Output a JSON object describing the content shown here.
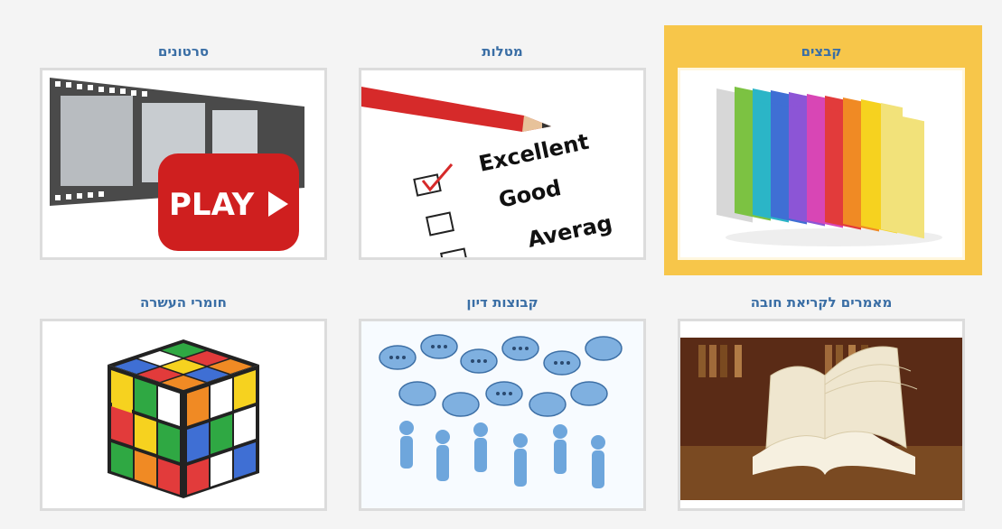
{
  "colors": {
    "title": "#3a6ea5",
    "selected": "#f7c64a",
    "frame_border": "#dcdcdc"
  },
  "tiles": [
    {
      "title": "קבצים",
      "image": "folders-icon",
      "selected": true
    },
    {
      "title": "מטלות",
      "image": "checklist-icon"
    },
    {
      "title": "סרטונים",
      "image": "video-play-icon"
    },
    {
      "title": "מאמרים לקריאת חובה",
      "image": "open-book-icon"
    },
    {
      "title": "קבוצות דיון",
      "image": "discussion-group-icon"
    },
    {
      "title": "חומרי העשרה",
      "image": "rubiks-cube-icon"
    }
  ],
  "images": {
    "play_label": "PLAY",
    "checklist": [
      "Excellent",
      "Good",
      "Averag"
    ]
  }
}
